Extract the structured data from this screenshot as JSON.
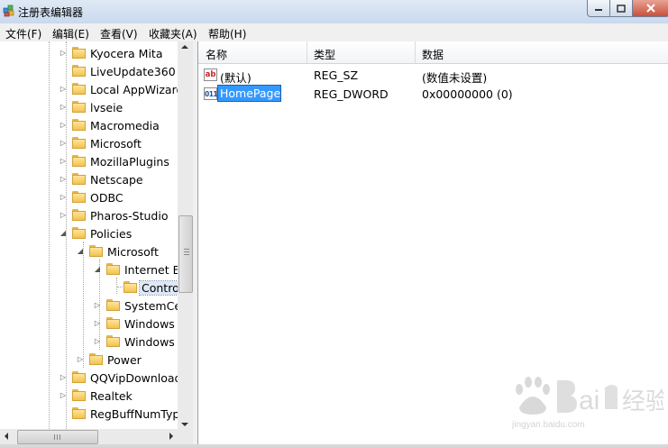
{
  "window": {
    "title": "注册表编辑器"
  },
  "menu": [
    {
      "label": "文件(F)"
    },
    {
      "label": "编辑(E)"
    },
    {
      "label": "查看(V)"
    },
    {
      "label": "收藏夹(A)"
    },
    {
      "label": "帮助(H)"
    }
  ],
  "tree": {
    "items": [
      {
        "label": "Kyocera Mita",
        "level": 0,
        "expander": "collapsed"
      },
      {
        "label": "LiveUpdate360",
        "level": 0,
        "expander": "none"
      },
      {
        "label": "Local AppWizard",
        "level": 0,
        "expander": "collapsed"
      },
      {
        "label": "lvseie",
        "level": 0,
        "expander": "collapsed"
      },
      {
        "label": "Macromedia",
        "level": 0,
        "expander": "collapsed"
      },
      {
        "label": "Microsoft",
        "level": 0,
        "expander": "collapsed"
      },
      {
        "label": "MozillaPlugins",
        "level": 0,
        "expander": "collapsed"
      },
      {
        "label": "Netscape",
        "level": 0,
        "expander": "collapsed"
      },
      {
        "label": "ODBC",
        "level": 0,
        "expander": "collapsed"
      },
      {
        "label": "Pharos-Studio",
        "level": 0,
        "expander": "collapsed"
      },
      {
        "label": "Policies",
        "level": 0,
        "expander": "expanded"
      },
      {
        "label": "Microsoft",
        "level": 1,
        "expander": "expanded"
      },
      {
        "label": "Internet E",
        "level": 2,
        "expander": "expanded"
      },
      {
        "label": "Contro",
        "level": 3,
        "expander": "none"
      },
      {
        "label": "SystemCe",
        "level": 2,
        "expander": "collapsed"
      },
      {
        "label": "Windows",
        "level": 2,
        "expander": "collapsed"
      },
      {
        "label": "Windows",
        "level": 2,
        "expander": "collapsed"
      },
      {
        "label": "Power",
        "level": 1,
        "expander": "collapsed"
      },
      {
        "label": "QQVipDownload",
        "level": 0,
        "expander": "collapsed"
      },
      {
        "label": "Realtek",
        "level": 0,
        "expander": "collapsed"
      },
      {
        "label": "RegBuffNumTyp",
        "level": 0,
        "expander": "none"
      }
    ],
    "selected_index": 13
  },
  "list": {
    "columns": [
      "名称",
      "类型",
      "数据"
    ],
    "rows": [
      {
        "name": "(默认)",
        "type": "REG_SZ",
        "data": "(数值未设置)",
        "icon": "string-value-icon",
        "icon_text": "ab"
      },
      {
        "name": "HomePage",
        "type": "REG_DWORD",
        "data": "0x00000000 (0)",
        "icon": "dword-value-icon",
        "icon_text": "011",
        "editing": true
      }
    ]
  },
  "colors": {
    "selection": "#3399ff",
    "folder": "#f2c24f"
  }
}
